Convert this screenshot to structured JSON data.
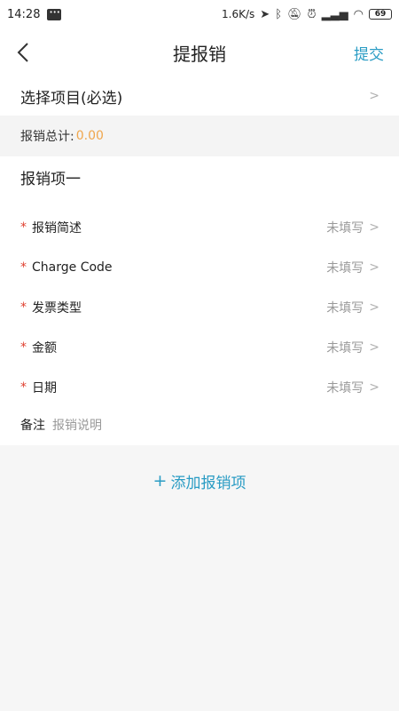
{
  "status_bar": {
    "time": "14:28",
    "speed": "1.6K/s",
    "battery": "69"
  },
  "nav": {
    "title": "提报销",
    "submit_label": "提交"
  },
  "project": {
    "label": "选择项目(必选)"
  },
  "total": {
    "label": "报销总计:",
    "value": "0.00"
  },
  "section": {
    "title": "报销项一",
    "fields": [
      {
        "label": "报销简述",
        "value": "未填写"
      },
      {
        "label": "Charge Code",
        "value": "未填写"
      },
      {
        "label": "发票类型",
        "value": "未填写"
      },
      {
        "label": "金额",
        "value": "未填写"
      },
      {
        "label": "日期",
        "value": "未填写"
      }
    ],
    "remark_label": "备注",
    "remark_placeholder": "报销说明"
  },
  "add_item": {
    "label": "添加报销项"
  }
}
